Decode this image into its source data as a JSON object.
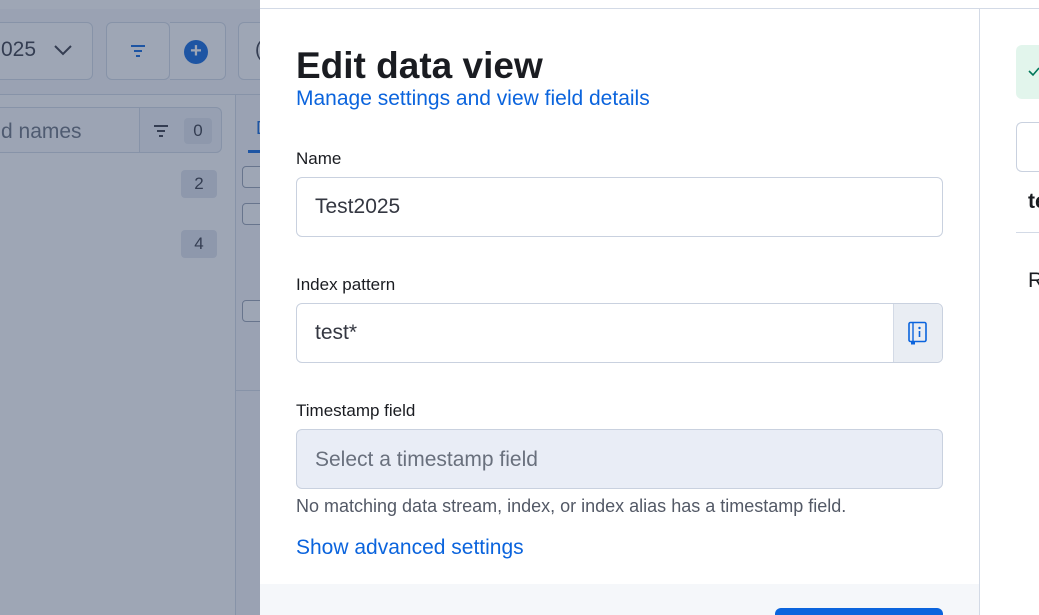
{
  "background": {
    "data_view_select_value": "025",
    "search_placeholder": "d names",
    "filter_count": "0",
    "field_counts": [
      "2",
      "4"
    ],
    "tab_label": "D"
  },
  "flyout": {
    "title": "Edit data view",
    "subtitle": "Manage settings and view field details",
    "name_field": {
      "label": "Name",
      "value": "Test2025"
    },
    "index_pattern_field": {
      "label": "Index pattern",
      "value": "test*",
      "append_icon": "documentation-icon"
    },
    "timestamp_field": {
      "label": "Timestamp field",
      "placeholder": "Select a timestamp field",
      "help_text": "No matching data stream, index, or index alias has a timestamp field."
    },
    "advanced_link": "Show advanced settings"
  },
  "right_pane": {
    "text_top": "te",
    "text_bottom": "R"
  },
  "colors": {
    "accent": "#0b64dd",
    "success_bg": "#e2f5ec",
    "overlay": "rgba(52,68,100,0.48)"
  }
}
